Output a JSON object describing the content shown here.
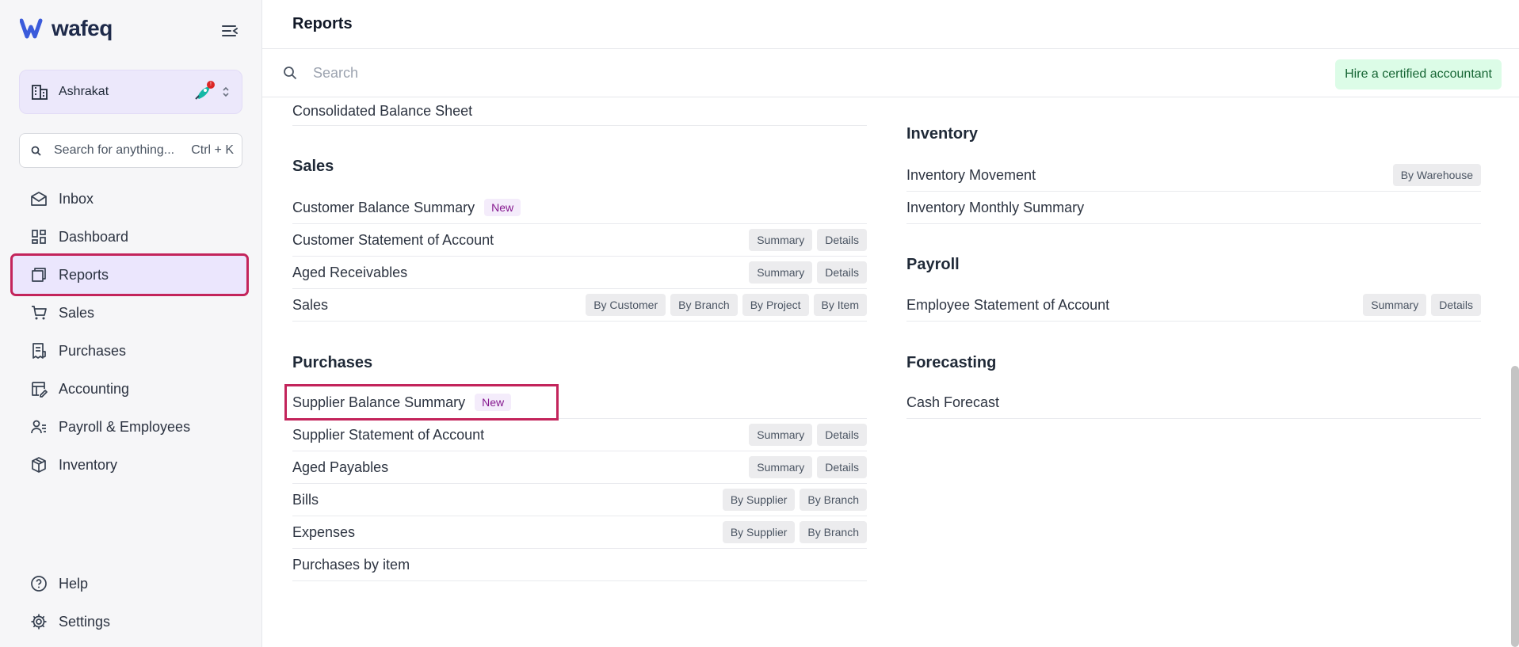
{
  "app": {
    "logo_text": "wafeq",
    "org_name": "Ashrakat",
    "notification_count": "!",
    "search_placeholder": "Search for anything...",
    "search_shortcut": "Ctrl + K"
  },
  "nav": {
    "items": [
      {
        "label": "Inbox",
        "icon": "inbox-icon"
      },
      {
        "label": "Dashboard",
        "icon": "dashboard-icon"
      },
      {
        "label": "Reports",
        "icon": "reports-icon",
        "active": true
      },
      {
        "label": "Sales",
        "icon": "cart-icon"
      },
      {
        "label": "Purchases",
        "icon": "receipt-icon"
      },
      {
        "label": "Accounting",
        "icon": "ledger-icon"
      },
      {
        "label": "Payroll & Employees",
        "icon": "people-icon"
      },
      {
        "label": "Inventory",
        "icon": "box-icon"
      }
    ],
    "bottom": [
      {
        "label": "Help",
        "icon": "help-icon"
      },
      {
        "label": "Settings",
        "icon": "gear-icon"
      }
    ]
  },
  "page": {
    "title": "Reports",
    "search_placeholder": "Search",
    "hire_label": "Hire a certified accountant"
  },
  "left": {
    "top_row": "Consolidated Balance Sheet",
    "sales": {
      "title": "Sales",
      "rows": [
        {
          "label": "Customer Balance Summary",
          "badge": "New",
          "chips": []
        },
        {
          "label": "Customer Statement of Account",
          "chips": [
            "Summary",
            "Details"
          ]
        },
        {
          "label": "Aged Receivables",
          "chips": [
            "Summary",
            "Details"
          ]
        },
        {
          "label": "Sales",
          "chips": [
            "By Customer",
            "By Branch",
            "By Project",
            "By Item"
          ]
        }
      ]
    },
    "purchases": {
      "title": "Purchases",
      "rows": [
        {
          "label": "Supplier Balance Summary",
          "badge": "New",
          "chips": []
        },
        {
          "label": "Supplier Statement of Account",
          "chips": [
            "Summary",
            "Details"
          ]
        },
        {
          "label": "Aged Payables",
          "chips": [
            "Summary",
            "Details"
          ]
        },
        {
          "label": "Bills",
          "chips": [
            "By Supplier",
            "By Branch"
          ]
        },
        {
          "label": "Expenses",
          "chips": [
            "By Supplier",
            "By Branch"
          ]
        },
        {
          "label": "Purchases by item",
          "chips": []
        }
      ]
    }
  },
  "right": {
    "inventory": {
      "title": "Inventory",
      "rows": [
        {
          "label": "Inventory Movement",
          "chips": [
            "By Warehouse"
          ]
        },
        {
          "label": "Inventory Monthly Summary",
          "chips": []
        }
      ]
    },
    "payroll": {
      "title": "Payroll",
      "rows": [
        {
          "label": "Employee Statement of Account",
          "chips": [
            "Summary",
            "Details"
          ]
        }
      ]
    },
    "forecasting": {
      "title": "Forecasting",
      "rows": [
        {
          "label": "Cash Forecast",
          "chips": []
        }
      ]
    }
  },
  "colors": {
    "accent": "#c3245b",
    "active_bg": "#ebe6fd",
    "new_badge": "#86198f",
    "hire_bg": "#dcfce7"
  }
}
